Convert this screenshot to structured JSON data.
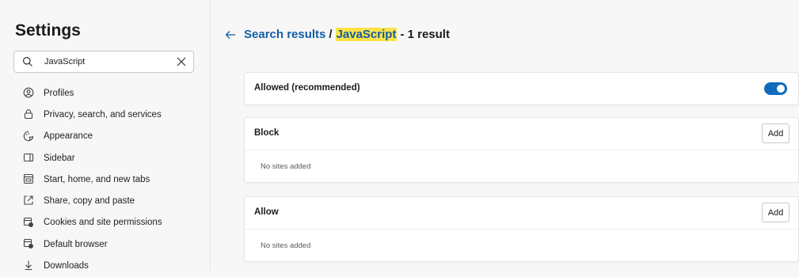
{
  "sidebar": {
    "title": "Settings",
    "search": {
      "value": "JavaScript"
    },
    "items": [
      {
        "label": "Profiles",
        "icon": "profile-icon"
      },
      {
        "label": "Privacy, search, and services",
        "icon": "lock-icon"
      },
      {
        "label": "Appearance",
        "icon": "appearance-icon"
      },
      {
        "label": "Sidebar",
        "icon": "sidebar-icon"
      },
      {
        "label": "Start, home, and new tabs",
        "icon": "home-tabs-icon"
      },
      {
        "label": "Share, copy and paste",
        "icon": "share-icon"
      },
      {
        "label": "Cookies and site permissions",
        "icon": "cookies-icon"
      },
      {
        "label": "Default browser",
        "icon": "browser-icon"
      },
      {
        "label": "Downloads",
        "icon": "download-icon"
      }
    ]
  },
  "header": {
    "breadcrumb_link": "Search results",
    "separator": "/",
    "highlight": "JavaScript",
    "count": "- 1 result"
  },
  "cards": {
    "allowed": {
      "label": "Allowed (recommended)",
      "toggle_on": true
    },
    "block": {
      "label": "Block",
      "add_label": "Add",
      "empty_text": "No sites added"
    },
    "allow": {
      "label": "Allow",
      "add_label": "Add",
      "empty_text": "No sites added"
    }
  },
  "colors": {
    "accent": "#0f6cbd",
    "link": "#125ea4",
    "highlight": "#fbe34a"
  }
}
